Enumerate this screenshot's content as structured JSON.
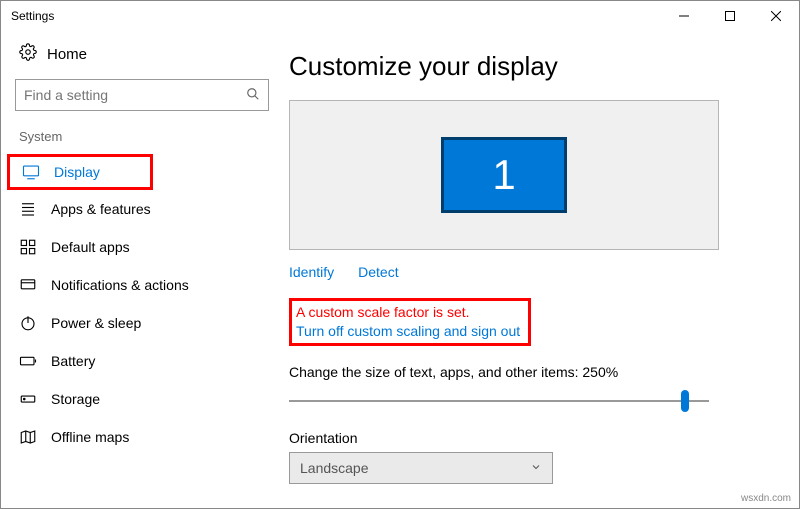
{
  "window": {
    "title": "Settings"
  },
  "sidebar": {
    "home_label": "Home",
    "search_placeholder": "Find a setting",
    "section_label": "System",
    "items": [
      {
        "label": "Display"
      },
      {
        "label": "Apps & features"
      },
      {
        "label": "Default apps"
      },
      {
        "label": "Notifications & actions"
      },
      {
        "label": "Power & sleep"
      },
      {
        "label": "Battery"
      },
      {
        "label": "Storage"
      },
      {
        "label": "Offline maps"
      }
    ]
  },
  "main": {
    "heading": "Customize your display",
    "monitor_number": "1",
    "identify_label": "Identify",
    "detect_label": "Detect",
    "warning_text": "A custom scale factor is set.",
    "turn_off_link": "Turn off custom scaling and sign out",
    "scale_label": "Change the size of text, apps, and other items: 250%",
    "orientation_label": "Orientation",
    "orientation_value": "Landscape"
  },
  "watermark": "wsxdn.com"
}
